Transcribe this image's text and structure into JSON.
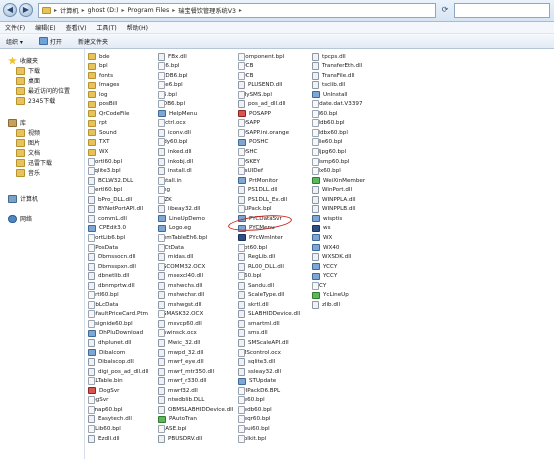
{
  "address": {
    "segments": [
      "计算机",
      "ghost (D:)",
      "Program Files",
      "瑞宝餐饮管理系统V3"
    ]
  },
  "menu": [
    "文件(F)",
    "编辑(E)",
    "查看(V)",
    "工具(T)",
    "帮助(H)"
  ],
  "toolbar": {
    "organize": "组织 ▾",
    "open": "打开",
    "new_folder": "新建文件夹"
  },
  "nav": [
    {
      "label": "收藏夹",
      "icon": "star-icon",
      "level": 0
    },
    {
      "label": "下载",
      "icon": "folder-icon",
      "level": 1
    },
    {
      "label": "桌面",
      "icon": "folder-icon",
      "level": 1
    },
    {
      "label": "最近访问的位置",
      "icon": "folder-icon",
      "level": 1
    },
    {
      "label": "2345下载",
      "icon": "folder-icon",
      "level": 1
    },
    {
      "label": "库",
      "icon": "library-icon",
      "level": 0
    },
    {
      "label": "视频",
      "icon": "folder-icon",
      "level": 1
    },
    {
      "label": "图片",
      "icon": "folder-icon",
      "level": 1
    },
    {
      "label": "文档",
      "icon": "folder-icon",
      "level": 1
    },
    {
      "label": "迅雷下载",
      "icon": "folder-icon",
      "level": 1
    },
    {
      "label": "音乐",
      "icon": "folder-icon",
      "level": 1
    },
    {
      "label": "计算机",
      "icon": "computer-icon",
      "level": 0
    },
    {
      "label": "网络",
      "icon": "network-icon",
      "level": 0
    }
  ],
  "columns": [
    [
      {
        "name": "bde",
        "t": "folder"
      },
      {
        "name": "bpl",
        "t": "folder"
      },
      {
        "name": "fonts",
        "t": "folder"
      },
      {
        "name": "Images",
        "t": "folder"
      },
      {
        "name": "log",
        "t": "folder"
      },
      {
        "name": "posBill",
        "t": "folder"
      },
      {
        "name": "QrCodeFile",
        "t": "folder"
      },
      {
        "name": "rpt",
        "t": "folder"
      },
      {
        "name": "Sound",
        "t": "folder"
      },
      {
        "name": "TXT",
        "t": "folder"
      },
      {
        "name": "WX",
        "t": "folder"
      },
      {
        "name": "adortl60.bpl",
        "t": "file"
      },
      {
        "name": "asqlite3.bpl",
        "t": "file"
      },
      {
        "name": "BCLW32.DLL",
        "t": "dll"
      },
      {
        "name": "bdertl60.bpl",
        "t": "file"
      },
      {
        "name": "bPro_DLL.dll",
        "t": "dll"
      },
      {
        "name": "BYNetPortAPI.dll",
        "t": "dll"
      },
      {
        "name": "commL.dll",
        "t": "dll"
      },
      {
        "name": "CPEdit3.0",
        "t": "exe"
      },
      {
        "name": "CPortLib6.bpl",
        "t": "file"
      },
      {
        "name": "CyPosData",
        "t": "file"
      },
      {
        "name": "Dbmssocn.dll",
        "t": "dll"
      },
      {
        "name": "Dbmsspxn.dll",
        "t": "dll"
      },
      {
        "name": "dbnetlib.dll",
        "t": "dll"
      },
      {
        "name": "dbnmprtw.dll",
        "t": "dll"
      },
      {
        "name": "dbrtl60.bpl",
        "t": "file"
      },
      {
        "name": "DcbLcData",
        "t": "file"
      },
      {
        "name": "DefaultPriceCard.Ptm",
        "t": "file"
      },
      {
        "name": "designide60.bpl",
        "t": "file"
      },
      {
        "name": "DhPluDownload",
        "t": "exe"
      },
      {
        "name": "dhplunet.dll",
        "t": "dll"
      },
      {
        "name": "Dibalcom",
        "t": "exe"
      },
      {
        "name": "Dibalscop.dll",
        "t": "dll"
      },
      {
        "name": "digi_pos_ad_dll.dll",
        "t": "dll"
      },
      {
        "name": "DLLTable.bin",
        "t": "file"
      },
      {
        "name": "DogSvr",
        "t": "red"
      },
      {
        "name": "DogSvr",
        "t": "file"
      },
      {
        "name": "dsnap60.bpl",
        "t": "file"
      },
      {
        "name": "Easytech.dll",
        "t": "dll"
      },
      {
        "name": "EhLib60.bpl",
        "t": "file"
      },
      {
        "name": "Ezdll.dll",
        "t": "dll"
      }
    ],
    [
      {
        "name": "FBx.dll",
        "t": "dll"
      },
      {
        "name": "frx6.bpl",
        "t": "file"
      },
      {
        "name": "frxDB6.bpl",
        "t": "file"
      },
      {
        "name": "frxe6.bpl",
        "t": "file"
      },
      {
        "name": "fs6.bpl",
        "t": "file"
      },
      {
        "name": "fsDB6.bpl",
        "t": "file"
      },
      {
        "name": "HelpMenu",
        "t": "exe"
      },
      {
        "name": "hhctrl.ocx",
        "t": "file"
      },
      {
        "name": "iconv.dll",
        "t": "dll"
      },
      {
        "name": "Indy60.bpl",
        "t": "file"
      },
      {
        "name": "inked.dll",
        "t": "dll"
      },
      {
        "name": "inkobj.dll",
        "t": "dll"
      },
      {
        "name": "install.dl",
        "t": "dll"
      },
      {
        "name": "Install.in",
        "t": "file"
      },
      {
        "name": "lang",
        "t": "file"
      },
      {
        "name": "LFZK",
        "t": "file"
      },
      {
        "name": "libeay32.dll",
        "t": "dll"
      },
      {
        "name": "LineUpDemo",
        "t": "exe"
      },
      {
        "name": "Logo.eg",
        "t": "exe"
      },
      {
        "name": "MemTableEh6.bpl",
        "t": "file"
      },
      {
        "name": "MICtData",
        "t": "file"
      },
      {
        "name": "midas.dll",
        "t": "dll"
      },
      {
        "name": "MSCOMM32.OCX",
        "t": "file"
      },
      {
        "name": "msexcl40.dll",
        "t": "dll"
      },
      {
        "name": "mshwchs.dll",
        "t": "dll"
      },
      {
        "name": "mshwchsr.dll",
        "t": "dll"
      },
      {
        "name": "mshwgst.dll",
        "t": "dll"
      },
      {
        "name": "MSMASK32.OCX",
        "t": "file"
      },
      {
        "name": "msvcp60.dll",
        "t": "dll"
      },
      {
        "name": "mswinsck.ocx",
        "t": "file"
      },
      {
        "name": "Mwic_32.dll",
        "t": "dll"
      },
      {
        "name": "mwpd_32.dll",
        "t": "dll"
      },
      {
        "name": "mwrf_eye.dll",
        "t": "dll"
      },
      {
        "name": "mwrf_mtr350.dll",
        "t": "dll"
      },
      {
        "name": "mwrf_r330.dll",
        "t": "dll"
      },
      {
        "name": "mwrf32.dll",
        "t": "dll"
      },
      {
        "name": "ntwdblib.DLL",
        "t": "dll"
      },
      {
        "name": "OBMSLABHIDDevice.dll",
        "t": "dll"
      },
      {
        "name": "PAutoTran",
        "t": "green"
      },
      {
        "name": "PBASE.bpl",
        "t": "file"
      },
      {
        "name": "PBUSDRV.dll",
        "t": "dll"
      }
    ],
    [
      {
        "name": "PComponent.bpl",
        "t": "file"
      },
      {
        "name": "PDCB",
        "t": "file"
      },
      {
        "name": "PDCB",
        "t": "file"
      },
      {
        "name": "PLUSEND.dll",
        "t": "dll"
      },
      {
        "name": "PMySMS.bpl",
        "t": "file"
      },
      {
        "name": "pos_ad_dll.dll",
        "t": "dll"
      },
      {
        "name": "POSAPP",
        "t": "red"
      },
      {
        "name": "POSAPP",
        "t": "file"
      },
      {
        "name": "POSAPP.ini.orange",
        "t": "file"
      },
      {
        "name": "POSHC",
        "t": "exe"
      },
      {
        "name": "POSHC",
        "t": "file"
      },
      {
        "name": "POSKEY",
        "t": "file"
      },
      {
        "name": "PosUIDef",
        "t": "file"
      },
      {
        "name": "PrtMonitor",
        "t": "exe"
      },
      {
        "name": "PS1DLL.dll",
        "t": "dll"
      },
      {
        "name": "PS1DLL_Ex.dll",
        "t": "dll"
      },
      {
        "name": "PLUPack.bpl",
        "t": "file"
      },
      {
        "name": "PYCDataSvr",
        "t": "exe"
      },
      {
        "name": "PYCMenu",
        "t": "exe"
      },
      {
        "name": "PYcWmInter",
        "t": "navy"
      },
      {
        "name": "qrpt60.bpl",
        "t": "file"
      },
      {
        "name": "RegLib.dll",
        "t": "dll"
      },
      {
        "name": "RL00_DLL.dll",
        "t": "dll"
      },
      {
        "name": "rtl60.bpl",
        "t": "file"
      },
      {
        "name": "Sandu.dll",
        "t": "dll"
      },
      {
        "name": "ScaleType.dll",
        "t": "dll"
      },
      {
        "name": "skrtl.dll",
        "t": "dll"
      },
      {
        "name": "SLABHIDDevice.dll",
        "t": "dll"
      },
      {
        "name": "smartml.dll",
        "t": "dll"
      },
      {
        "name": "sms.dll",
        "t": "dll"
      },
      {
        "name": "SMScaleAPI.dll",
        "t": "dll"
      },
      {
        "name": "SMScontrol.ocx",
        "t": "file"
      },
      {
        "name": "sqlite3.dll",
        "t": "dll"
      },
      {
        "name": "ssleay32.dll",
        "t": "dll"
      },
      {
        "name": "STUpdate",
        "t": "exe"
      },
      {
        "name": "SUIPackD6.BPL",
        "t": "file"
      },
      {
        "name": "tee60.bpl",
        "t": "file"
      },
      {
        "name": "teedb60.bpl",
        "t": "file"
      },
      {
        "name": "teeqr60.bpl",
        "t": "file"
      },
      {
        "name": "teeui60.bpl",
        "t": "file"
      },
      {
        "name": "Toolkit.bpl",
        "t": "file"
      }
    ],
    [
      {
        "name": "tpcps.dll",
        "t": "dll"
      },
      {
        "name": "TransferEth.dll",
        "t": "dll"
      },
      {
        "name": "TransFile.dll",
        "t": "dll"
      },
      {
        "name": "tsclib.dll",
        "t": "dll"
      },
      {
        "name": "UnInstall",
        "t": "exe"
      },
      {
        "name": "update.dat.V3397",
        "t": "file"
      },
      {
        "name": "vcl60.bpl",
        "t": "file"
      },
      {
        "name": "vcldb60.bpl",
        "t": "file"
      },
      {
        "name": "vcldbx60.bpl",
        "t": "file"
      },
      {
        "name": "vclie60.bpl",
        "t": "file"
      },
      {
        "name": "vcljpg60.bpl",
        "t": "file"
      },
      {
        "name": "vclsmp60.bpl",
        "t": "file"
      },
      {
        "name": "vclx60.bpl",
        "t": "file"
      },
      {
        "name": "WeiXinMember",
        "t": "green"
      },
      {
        "name": "WinPort.dll",
        "t": "dll"
      },
      {
        "name": "WINPPLA.dll",
        "t": "dll"
      },
      {
        "name": "WINPPLB.dll",
        "t": "dll"
      },
      {
        "name": "wisptis",
        "t": "exe"
      },
      {
        "name": "ws",
        "t": "navy"
      },
      {
        "name": "WX",
        "t": "exe"
      },
      {
        "name": "WX40",
        "t": "exe"
      },
      {
        "name": "WXSDK.dll",
        "t": "dll"
      },
      {
        "name": "YCCY",
        "t": "exe"
      },
      {
        "name": "YCCY",
        "t": "exe"
      },
      {
        "name": "YCCY",
        "t": "file"
      },
      {
        "name": "YcLineUp",
        "t": "green"
      },
      {
        "name": "zlib.dll",
        "t": "dll"
      }
    ]
  ],
  "colors": {
    "highlight_circle": "#c8221c",
    "folder": "#e8c25d",
    "accent": "#2b4a72"
  }
}
